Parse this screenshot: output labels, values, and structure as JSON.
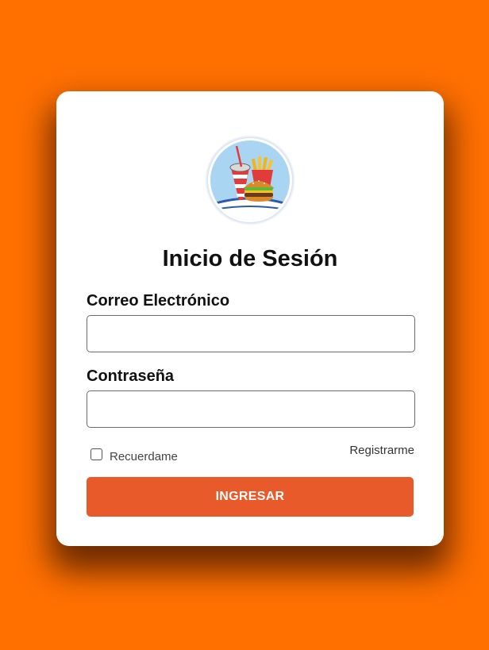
{
  "login": {
    "title": "Inicio de Sesión",
    "email_label": "Correo Electrónico",
    "email_value": "",
    "password_label": "Contraseña",
    "password_value": "",
    "remember_label": "Recuerdame",
    "remember_checked": false,
    "register_link": "Registrarme",
    "submit_label": "INGRESAR"
  },
  "icons": {
    "logo": "fast-food-logo-icon"
  },
  "colors": {
    "background": "#FF7000",
    "card": "#FFFFFF",
    "button": "#E85A29",
    "button_text": "#FFFFFF",
    "logo_ring": "#2B5BA8",
    "logo_fill": "#A9D4F2"
  }
}
